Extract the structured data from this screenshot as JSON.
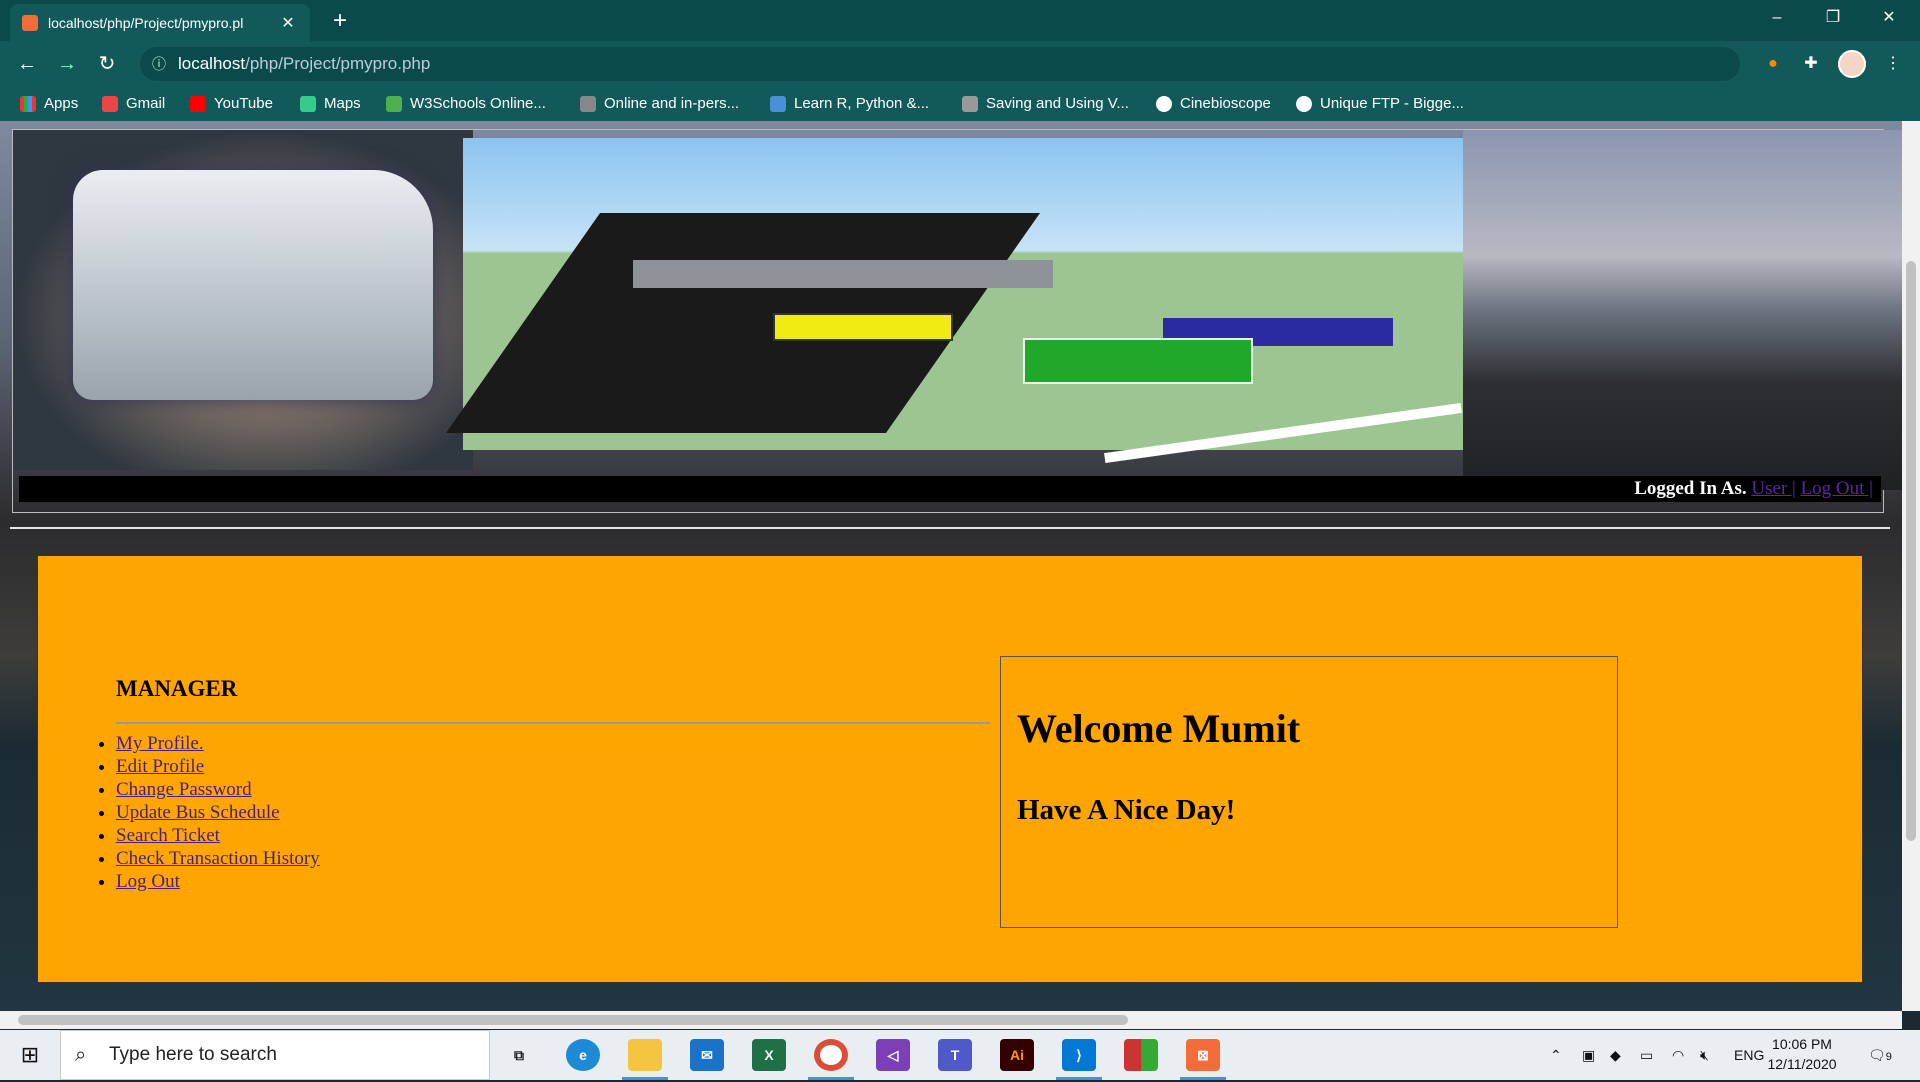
{
  "browser": {
    "tab_title": "localhost/php/Project/pmypro.pl",
    "url_host": "localhost",
    "url_path": "/php/Project/pmypro.php",
    "bookmarks": [
      "Apps",
      "Gmail",
      "YouTube",
      "Maps",
      "W3Schools Online...",
      "Online and in-pers...",
      "Learn R, Python &...",
      "Saving and Using V...",
      "Cinebioscope",
      "Unique FTP - Bigge..."
    ]
  },
  "header": {
    "logged_in_label": "Logged In As.",
    "user_link": "User |",
    "logout_link": "Log Out |"
  },
  "menu": {
    "title": "MANAGER",
    "items": [
      "My Profile.",
      "Edit Profile",
      "Change Password",
      "Update Bus Schedule",
      "Search Ticket",
      "Check Transaction History",
      "Log Out"
    ]
  },
  "welcome": {
    "heading": "Welcome Mumit",
    "subheading": "Have A Nice Day!"
  },
  "taskbar": {
    "search_placeholder": "Type here to search",
    "language": "ENG",
    "time": "10:06 PM",
    "date": "12/11/2020",
    "notification_count": "9"
  },
  "colors": {
    "panel": "#ffa500",
    "chrome": "#125a5a",
    "link": "#4a1f7a"
  }
}
